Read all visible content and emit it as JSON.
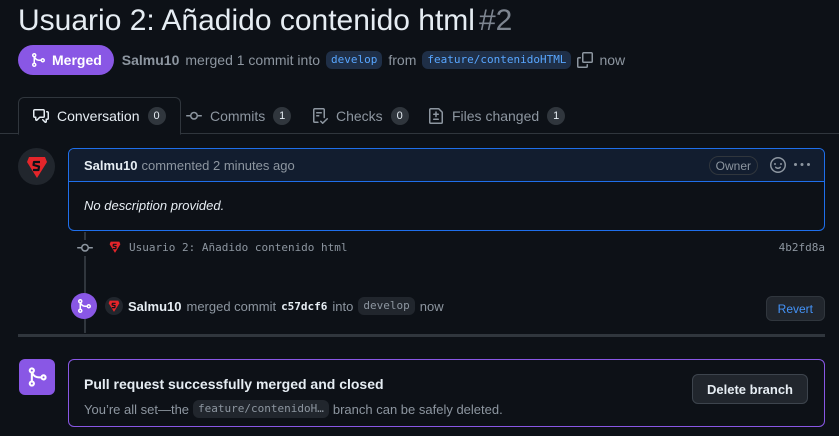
{
  "pr": {
    "title": "Usuario 2: Añadido contenido html",
    "number": "#2",
    "state_label": "Merged",
    "author": "Salmu10",
    "merged_text": "merged 1 commit into",
    "base_branch": "develop",
    "from_text": "from",
    "head_branch": "feature/contenidoHTML",
    "time": "now"
  },
  "tabs": [
    {
      "label": "Conversation",
      "count": "0"
    },
    {
      "label": "Commits",
      "count": "1"
    },
    {
      "label": "Checks",
      "count": "0"
    },
    {
      "label": "Files changed",
      "count": "1"
    }
  ],
  "comment": {
    "author": "Salmu10",
    "action": "commented 2 minutes ago",
    "role": "Owner",
    "body": "No description provided."
  },
  "commit": {
    "message": "Usuario 2: Añadido contenido html",
    "sha": "4b2fd8a"
  },
  "merge_event": {
    "author": "Salmu10",
    "action": "merged commit",
    "sha": "c57dcf6",
    "into_text": "into",
    "branch": "develop",
    "time": "now",
    "revert_label": "Revert"
  },
  "merged_box": {
    "title": "Pull request successfully merged and closed",
    "sub_before": "You’re all set—the",
    "branch": "feature/contenidoH…",
    "sub_after": "branch can be safely deleted.",
    "delete_label": "Delete branch"
  },
  "colors": {
    "merged_purple": "#8957e5",
    "link_blue": "#58a6ff",
    "avatar_red": "#e5252a"
  },
  "icons": [
    "git-merge-icon",
    "copy-icon",
    "comment-discussion-icon",
    "git-commit-icon",
    "checklist-icon",
    "file-diff-icon",
    "smiley-icon",
    "kebab-horizontal-icon"
  ]
}
